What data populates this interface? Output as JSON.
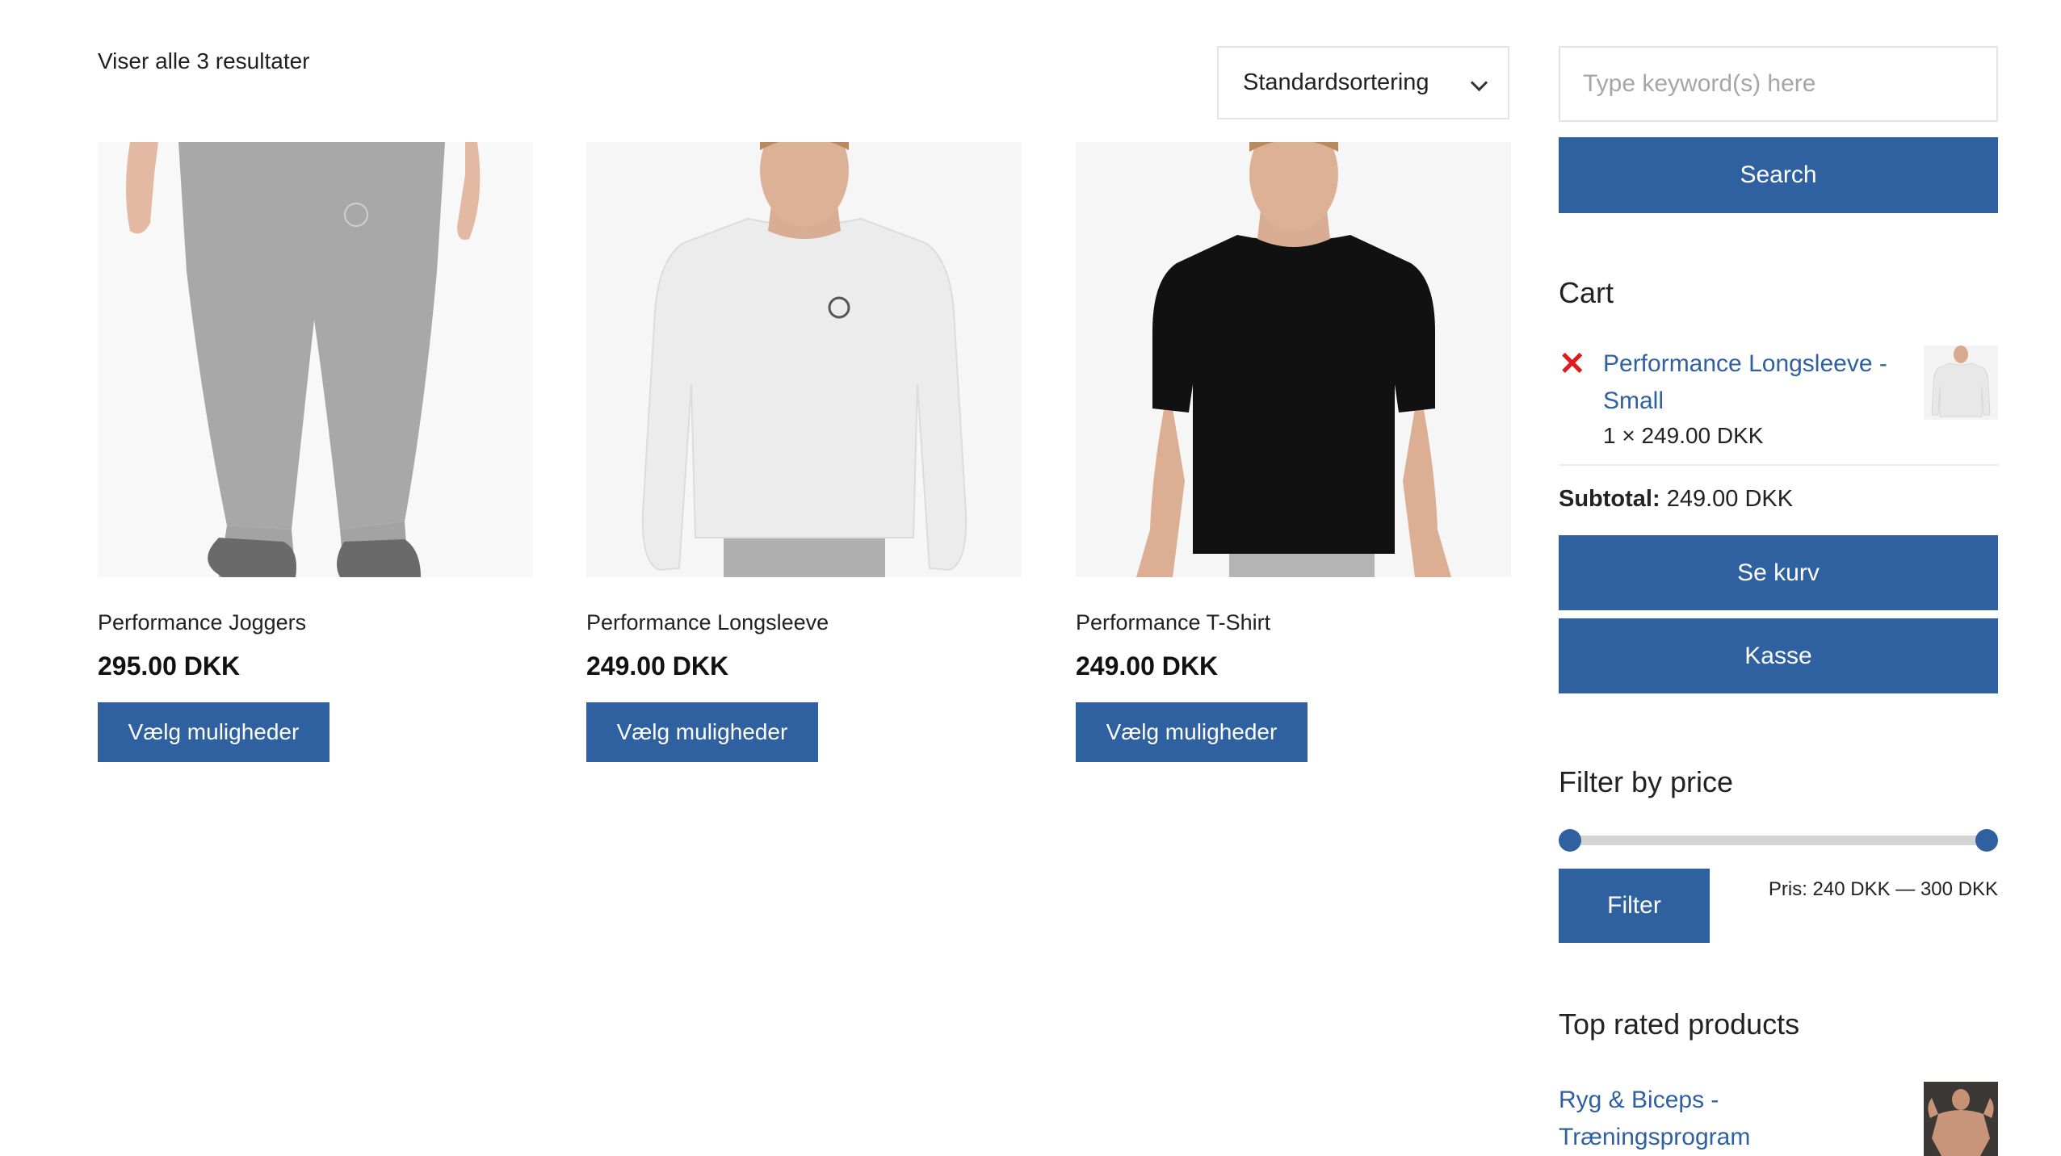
{
  "results": {
    "count_text": "Viser alle 3 resultater"
  },
  "sorting": {
    "selected": "Standardsortering"
  },
  "products": [
    {
      "name": "Performance Joggers",
      "price": "295.00 DKK",
      "button": "Vælg muligheder"
    },
    {
      "name": "Performance Longsleeve",
      "price": "249.00 DKK",
      "button": "Vælg muligheder"
    },
    {
      "name": "Performance T-Shirt",
      "price": "249.00 DKK",
      "button": "Vælg muligheder"
    }
  ],
  "search": {
    "placeholder": "Type keyword(s) here",
    "button": "Search"
  },
  "cart": {
    "title": "Cart",
    "remove_icon": "✕",
    "item_name": "Performance Longsleeve - Small",
    "item_qty": "1 × 249.00 DKK",
    "subtotal_label": "Subtotal:",
    "subtotal_value": "249.00 DKK",
    "view_cart": "Se kurv",
    "checkout": "Kasse"
  },
  "price_filter": {
    "title": "Filter by price",
    "button": "Filter",
    "range_label": "Pris: 240 DKK — 300 DKK",
    "min_fraction": 0,
    "max_fraction": 1
  },
  "top_rated": {
    "title": "Top rated products",
    "item": "Ryg & Biceps - Træningsprogram"
  },
  "colors": {
    "accent": "#2f60a0",
    "remove": "#e01b1b"
  }
}
